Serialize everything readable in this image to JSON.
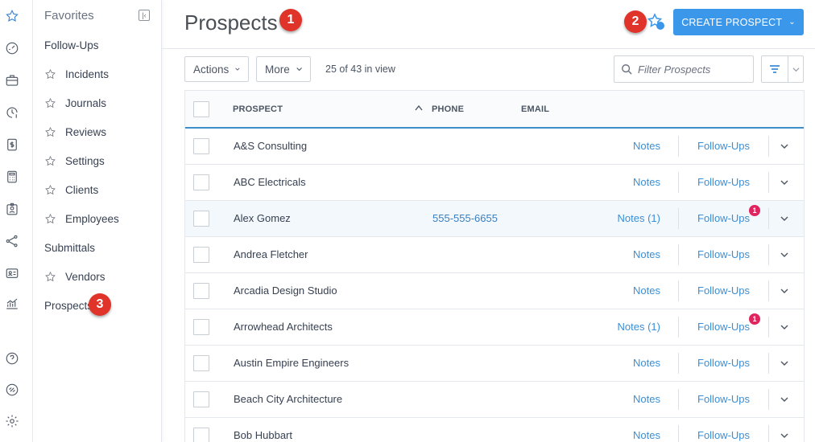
{
  "rail": {
    "icons": [
      "star-icon",
      "dashboard-icon",
      "briefcase-icon",
      "clock-dollar-icon",
      "invoice-icon",
      "calculator-icon",
      "badge-icon",
      "network-icon",
      "contact-card-icon",
      "chart-icon",
      "help-icon",
      "integration-icon",
      "settings-icon"
    ]
  },
  "favorites": {
    "title": "Favorites",
    "items": [
      {
        "label": "Follow-Ups",
        "star": false
      },
      {
        "label": "Incidents",
        "star": true
      },
      {
        "label": "Journals",
        "star": true
      },
      {
        "label": "Reviews",
        "star": true
      },
      {
        "label": "Settings",
        "star": true
      },
      {
        "label": "Clients",
        "star": true
      },
      {
        "label": "Employees",
        "star": true
      },
      {
        "label": "Submittals",
        "star": false
      },
      {
        "label": "Vendors",
        "star": true
      },
      {
        "label": "Prospects",
        "star": false
      }
    ]
  },
  "callouts": [
    "1",
    "2",
    "3"
  ],
  "header": {
    "title": "Prospects",
    "create_label": "CREATE PROSPECT"
  },
  "toolbar": {
    "actions_label": "Actions",
    "more_label": "More",
    "view_count": "25 of 43 in view",
    "filter_placeholder": "Filter Prospects"
  },
  "table": {
    "columns": {
      "prospect": "PROSPECT",
      "phone": "PHONE",
      "email": "EMAIL"
    },
    "rows": [
      {
        "name": "A&S Consulting",
        "phone": "",
        "notes": "Notes",
        "followups": "Follow-Ups",
        "badge": ""
      },
      {
        "name": "ABC Electricals",
        "phone": "",
        "notes": "Notes",
        "followups": "Follow-Ups",
        "badge": ""
      },
      {
        "name": "Alex Gomez",
        "phone": "555-555-6655",
        "notes": "Notes (1)",
        "followups": "Follow-Ups",
        "badge": "1"
      },
      {
        "name": "Andrea Fletcher",
        "phone": "",
        "notes": "Notes",
        "followups": "Follow-Ups",
        "badge": ""
      },
      {
        "name": "Arcadia Design Studio",
        "phone": "",
        "notes": "Notes",
        "followups": "Follow-Ups",
        "badge": ""
      },
      {
        "name": "Arrowhead Architects",
        "phone": "",
        "notes": "Notes (1)",
        "followups": "Follow-Ups",
        "badge": "1"
      },
      {
        "name": "Austin Empire Engineers",
        "phone": "",
        "notes": "Notes",
        "followups": "Follow-Ups",
        "badge": ""
      },
      {
        "name": "Beach City Architecture",
        "phone": "",
        "notes": "Notes",
        "followups": "Follow-Ups",
        "badge": ""
      },
      {
        "name": "Bob Hubbart",
        "phone": "",
        "notes": "Notes",
        "followups": "Follow-Ups",
        "badge": ""
      }
    ]
  },
  "colors": {
    "accent": "#3a97ea",
    "callout": "#e0342a",
    "badge": "#e0245e",
    "link": "#3a8fd6"
  }
}
